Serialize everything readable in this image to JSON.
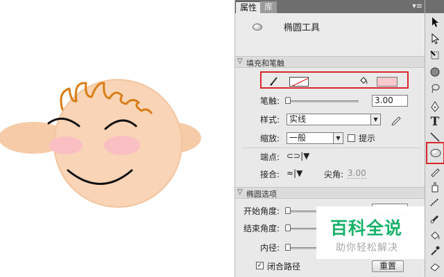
{
  "panel": {
    "tabs": [
      "属性",
      "库"
    ],
    "menu_icon": "panel-menu-icon",
    "tool_name": "椭圆工具",
    "fill_stroke": {
      "section_title": "填充和笔触",
      "stroke_icon": "pencil-icon",
      "fill_icon": "paint-bucket-icon",
      "stroke_color": "none",
      "fill_color": "#F7C8CD",
      "stroke_width_label": "笔触:",
      "stroke_width_value": "3.00",
      "style_label": "样式:",
      "style_value": "实线",
      "scale_label": "缩放:",
      "scale_value": "一般",
      "hint_label": "提示",
      "cap_label": "端点:",
      "join_label": "接合:",
      "miter_label": "尖角:",
      "miter_value": "3.00"
    },
    "oval_options": {
      "section_title": "椭圆选项",
      "start_angle_label": "开始角度:",
      "end_angle_label": "结束角度:",
      "inner_radius_label": "内径:",
      "close_path_label": "闭合路径",
      "close_path_checked": true,
      "reset_label": "重置"
    }
  },
  "toolbar": {
    "tools": [
      "selection-tool",
      "subselection-tool",
      "free-transform-tool",
      "3d-rotation-tool",
      "lasso-tool",
      "pen-tool",
      "text-tool",
      "line-tool",
      "oval-tool",
      "pencil-tool",
      "deco-tool",
      "brush-tool",
      "bone-tool",
      "paint-bucket-tool",
      "eyedropper-tool",
      "eraser-tool"
    ],
    "active_tool": "oval-tool",
    "text_tool_glyph": "T"
  },
  "watermark": {
    "title": "百科全说",
    "subtitle": "助你轻松解决"
  },
  "colors": {
    "highlight": "#D9252C",
    "face": "#F9D4B6",
    "ears": "#F6CBA8",
    "blush": "#F9BFC3",
    "hair": "#D97D16",
    "watermark_green": "#19B26B"
  }
}
